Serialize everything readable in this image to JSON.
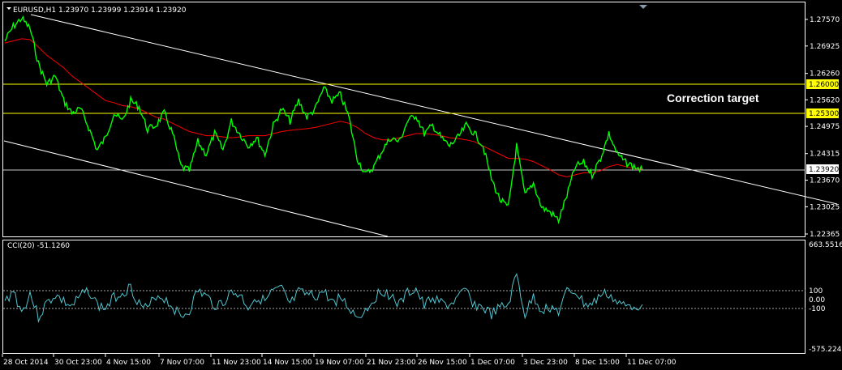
{
  "main": {
    "symbol": "EURUSD,H1",
    "ohlc": "1.23970 1.23999 1.23914 1.23920",
    "annotation": "Correction target",
    "price_ticks": [
      "1.27570",
      "1.26925",
      "1.26260",
      "1.25620",
      "1.24975",
      "1.24315",
      "1.23670",
      "1.23025",
      "1.22365"
    ],
    "levels": [
      {
        "label": "1.26000",
        "color": "#ffff00"
      },
      {
        "label": "1.25300",
        "color": "#ffff00"
      },
      {
        "label": "1.23920",
        "color": "#ffffff",
        "current": true
      }
    ]
  },
  "indicator": {
    "title": "CCI(20) -51.1260",
    "ticks_top": "663.5516",
    "ticks_100": "100",
    "ticks_0": "0.00",
    "ticks_m100": "-100",
    "ticks_bottom": "-575.2247"
  },
  "time_axis": [
    "28 Oct 2014",
    "30 Oct 23:00",
    "4 Nov 15:00",
    "7 Nov 07:00",
    "11 Nov 23:00",
    "14 Nov 15:00",
    "19 Nov 07:00",
    "21 Nov 23:00",
    "26 Nov 15:00",
    "1 Dec 07:00",
    "3 Dec 23:00",
    "8 Dec 15:00",
    "11 Dec 07:00"
  ],
  "colors": {
    "price_line": "#00ff00",
    "ma_line": "#ff0000",
    "cci_line": "#4fc6d0",
    "level_line": "#ffff00",
    "trend_line": "#ffffff"
  },
  "chart_data": {
    "type": "line",
    "series": [
      {
        "name": "EURUSD,H1",
        "values": [
          1.2705,
          1.274,
          1.276,
          1.2735,
          1.265,
          1.26,
          1.262,
          1.256,
          1.253,
          1.254,
          1.2495,
          1.244,
          1.247,
          1.253,
          1.251,
          1.256,
          1.2545,
          1.249,
          1.25,
          1.253,
          1.248,
          1.24,
          1.239,
          1.246,
          1.243,
          1.248,
          1.244,
          1.251,
          1.248,
          1.245,
          1.247,
          1.243,
          1.25,
          1.254,
          1.251,
          1.256,
          1.252,
          1.254,
          1.259,
          1.256,
          1.2575,
          1.252,
          1.242,
          1.238,
          1.24,
          1.244,
          1.247,
          1.246,
          1.251,
          1.2525,
          1.248,
          1.25,
          1.247,
          1.245,
          1.247,
          1.25,
          1.248,
          1.245,
          1.237,
          1.232,
          1.23,
          1.245,
          1.233,
          1.236,
          1.23,
          1.229,
          1.227,
          1.233,
          1.24,
          1.241,
          1.238,
          1.242,
          1.248,
          1.243,
          1.241,
          1.24,
          1.2392
        ]
      },
      {
        "name": "MA",
        "values": [
          1.27,
          1.2705,
          1.271,
          1.2708,
          1.269,
          1.267,
          1.2655,
          1.264,
          1.262,
          1.2605,
          1.259,
          1.2575,
          1.256,
          1.2555,
          1.2548,
          1.2545,
          1.254,
          1.253,
          1.252,
          1.2515,
          1.2505,
          1.2495,
          1.2485,
          1.248,
          1.2475,
          1.2475,
          1.2472,
          1.247,
          1.2472,
          1.2475,
          1.2475,
          1.2475,
          1.248,
          1.2485,
          1.2488,
          1.249,
          1.2492,
          1.2495,
          1.25,
          1.2505,
          1.251,
          1.2505,
          1.2495,
          1.248,
          1.247,
          1.2465,
          1.2465,
          1.247,
          1.2475,
          1.248,
          1.248,
          1.2478,
          1.2475,
          1.247,
          1.2468,
          1.2465,
          1.246,
          1.245,
          1.244,
          1.243,
          1.242,
          1.242,
          1.2418,
          1.2412,
          1.2402,
          1.2392,
          1.238,
          1.2375,
          1.238,
          1.2385,
          1.2385,
          1.239,
          1.24,
          1.2405,
          1.24,
          1.2395,
          1.2393
        ]
      },
      {
        "name": "CCI(20)",
        "values": [
          -30,
          120,
          -150,
          80,
          -200,
          -40,
          60,
          -20,
          -80,
          40,
          120,
          -60,
          -100,
          30,
          90,
          150,
          -40,
          -120,
          60,
          20,
          -80,
          -200,
          -120,
          110,
          40,
          -60,
          -30,
          90,
          60,
          -80,
          40,
          -20,
          100,
          120,
          -60,
          80,
          60,
          40,
          100,
          -30,
          30,
          -90,
          -200,
          -120,
          20,
          110,
          60,
          -60,
          80,
          130,
          -80,
          40,
          -40,
          -60,
          20,
          110,
          -60,
          -90,
          -170,
          -100,
          -60,
          300,
          -180,
          40,
          -120,
          -80,
          -140,
          90,
          100,
          -40,
          -60,
          60,
          70,
          -40,
          -80,
          -60,
          -51
        ]
      }
    ]
  }
}
